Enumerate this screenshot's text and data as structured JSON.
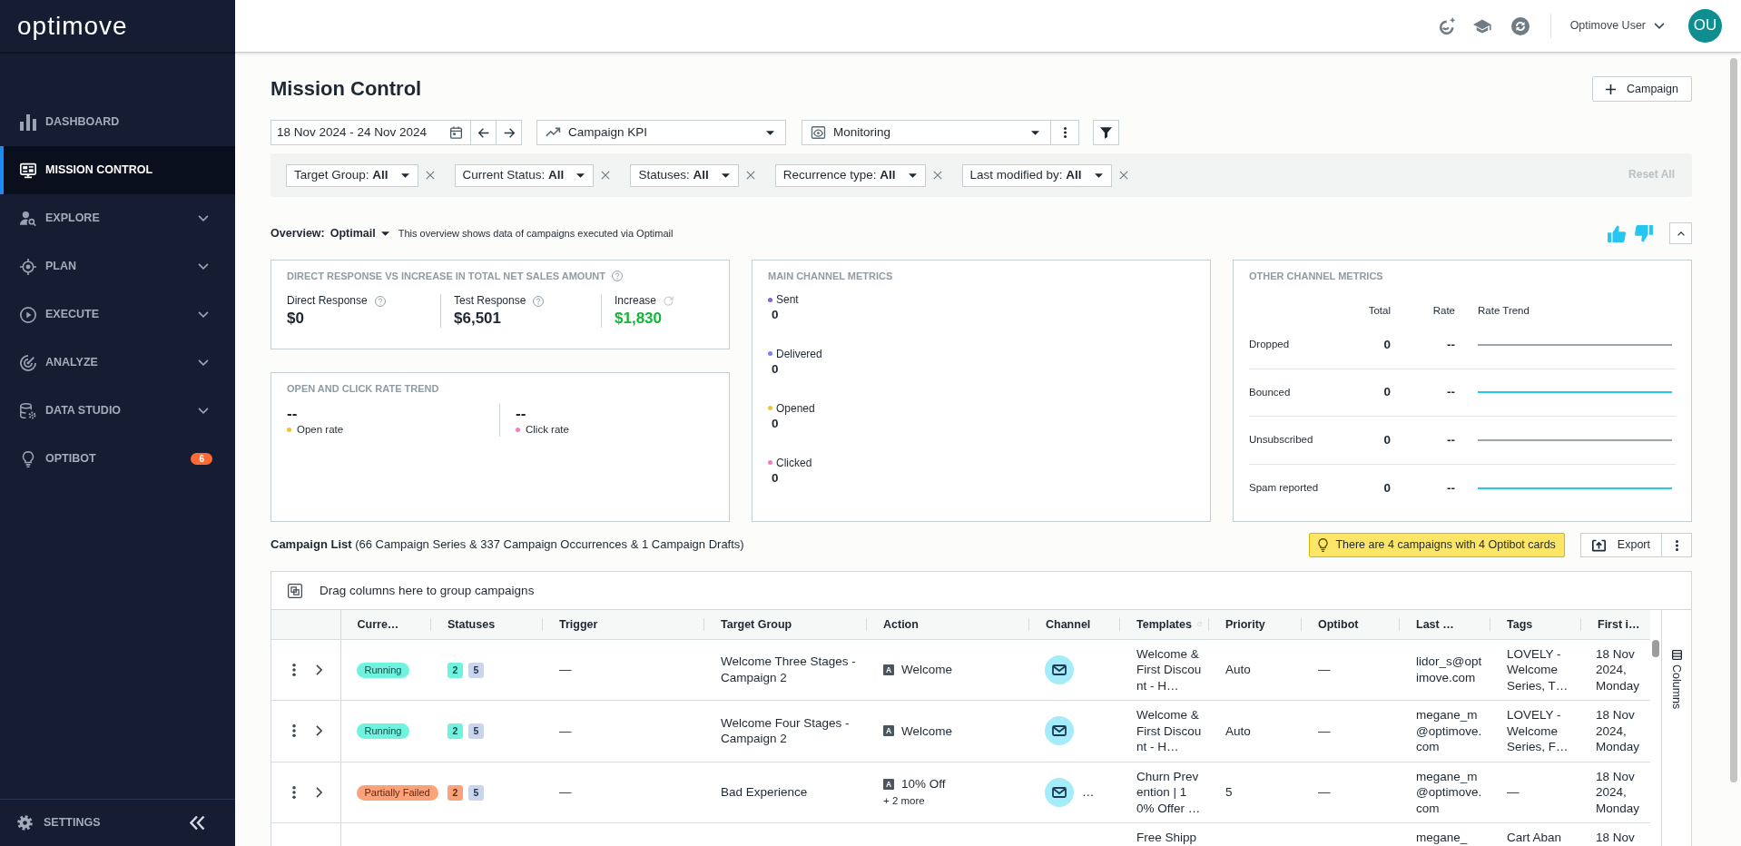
{
  "sidebar": {
    "logo": "optimove",
    "items": [
      {
        "label": "DASHBOARD",
        "selected": false,
        "expandable": false
      },
      {
        "label": "MISSION CONTROL",
        "selected": true,
        "expandable": false
      },
      {
        "label": "EXPLORE",
        "selected": false,
        "expandable": true
      },
      {
        "label": "PLAN",
        "selected": false,
        "expandable": true
      },
      {
        "label": "EXECUTE",
        "selected": false,
        "expandable": true
      },
      {
        "label": "ANALYZE",
        "selected": false,
        "expandable": true
      },
      {
        "label": "DATA STUDIO",
        "selected": false,
        "expandable": true
      },
      {
        "label": "OPTIBOT",
        "selected": false,
        "expandable": false,
        "badge": "6"
      }
    ],
    "footer": {
      "label": "SETTINGS"
    }
  },
  "header": {
    "user": "Optimove User",
    "avatar": "OU"
  },
  "page": {
    "title": "Mission Control",
    "add_button": "Campaign"
  },
  "toolbar": {
    "date_range": "18 Nov 2024 - 24 Nov 2024",
    "kpi": "Campaign KPI",
    "view": "Monitoring"
  },
  "filters": {
    "chips": [
      {
        "text": "Target Group: **All**"
      },
      {
        "text": "Current Status: **All**"
      },
      {
        "text": "Statuses: **All**"
      },
      {
        "text": "Recurrence type: **All**"
      },
      {
        "text": "Last modified by: **All**"
      }
    ],
    "reset": {
      "label": "Reset All",
      "disabled": true
    }
  },
  "overview": {
    "label": "Overview:",
    "source": "Optimail",
    "note": "This overview shows data of campaigns executed via Optimail"
  },
  "direct_response": {
    "title": "DIRECT RESPONSE VS INCREASE IN TOTAL NET SALES AMOUNT",
    "metrics": [
      {
        "kind": "help",
        "label": "Direct Response",
        "value": "$0"
      },
      {
        "kind": "help",
        "label": "Test Response",
        "value": "$6,501"
      },
      {
        "kind": "increase",
        "label": "Increase",
        "value": "$1,830"
      }
    ]
  },
  "open_click": {
    "title": "OPEN AND CLICK RATE TREND",
    "metrics": [
      {
        "label": "Open rate",
        "value": "--",
        "color": "#f2c230"
      },
      {
        "label": "Click rate",
        "value": "--",
        "color": "#f07ec0"
      }
    ]
  },
  "main_channel": {
    "title": "MAIN CHANNEL METRICS",
    "metrics": [
      {
        "label": "Sent",
        "value": "0",
        "color": "#8b5fd6"
      },
      {
        "label": "Delivered",
        "value": "0",
        "color": "#7c83e6"
      },
      {
        "label": "Opened",
        "value": "0",
        "color": "#f2c230"
      },
      {
        "label": "Clicked",
        "value": "0",
        "color": "#f07ec0"
      }
    ]
  },
  "other_channel": {
    "title": "OTHER CHANNEL METRICS",
    "columns": [
      "Total",
      "Rate",
      "Rate Trend"
    ],
    "rows": [
      {
        "label": "Dropped",
        "total": "0",
        "rate": "--",
        "color": "#9aa4a9"
      },
      {
        "label": "Bounced",
        "total": "0",
        "rate": "--",
        "color": "#25c6f2"
      },
      {
        "label": "Unsubscribed",
        "total": "0",
        "rate": "--",
        "color": "#9aa4a9"
      },
      {
        "label": "Spam reported",
        "total": "0",
        "rate": "--",
        "color": "#25c6f2"
      }
    ]
  },
  "campaign_list": {
    "heading": "**Campaign List** (66 Campaign Series & 337 Campaign Occurrences & 1 Campaign Drafts)",
    "optibot_alert": "There are 4 campaigns with 4 Optibot cards",
    "export": "Export",
    "group_hint": "Drag columns here to group campaigns",
    "columns": [
      {
        "label": "Curre…",
        "kind": "plain"
      },
      {
        "label": "Statuses",
        "kind": "plain"
      },
      {
        "label": "Trigger",
        "kind": "plain"
      },
      {
        "label": "Target Group",
        "kind": "plain"
      },
      {
        "label": "Action",
        "kind": "plain"
      },
      {
        "label": "Channel",
        "kind": "plain"
      },
      {
        "label": "Templates",
        "kind": "refresh"
      },
      {
        "label": "Priority",
        "kind": "plain"
      },
      {
        "label": "Optibot",
        "kind": "plain"
      },
      {
        "label": "Last …",
        "kind": "plain"
      },
      {
        "label": "Tags",
        "kind": "plain"
      },
      {
        "label": "First i…",
        "kind": "plain"
      }
    ],
    "rows": [
      {
        "current": {
          "label": "Running",
          "kind": "running"
        },
        "statuses": [
          {
            "count": "2",
            "kind": "running"
          },
          {
            "count": "5",
            "kind": "total"
          }
        ],
        "trigger": "—",
        "target_group": "Welcome Three Stages - Campaign 2",
        "action": {
          "tag": "A",
          "name": "Welcome"
        },
        "channel": {
          "kind": "email"
        },
        "template": "Welcome & First Discount - H…",
        "priority": "Auto",
        "optibot": "—",
        "last": "lidor_s@optimove.com",
        "tags": "LOVELY - Welcome Series, T…",
        "first": "18 Nov 2024, Monday"
      },
      {
        "current": {
          "label": "Running",
          "kind": "running"
        },
        "statuses": [
          {
            "count": "2",
            "kind": "running"
          },
          {
            "count": "5",
            "kind": "total"
          }
        ],
        "trigger": "—",
        "target_group": "Welcome Four Stages - Campaign 2",
        "action": {
          "tag": "A",
          "name": "Welcome"
        },
        "channel": {
          "kind": "email"
        },
        "template": "Welcome & First Discount - H…",
        "priority": "Auto",
        "optibot": "—",
        "last": "megane_m@optimove.com",
        "tags": "LOVELY - Welcome Series, F…",
        "first": "18 Nov 2024, Monday"
      },
      {
        "current": {
          "label": "Partially Failed",
          "kind": "failed"
        },
        "statuses": [
          {
            "count": "2",
            "kind": "failed"
          },
          {
            "count": "5",
            "kind": "total"
          }
        ],
        "trigger": "—",
        "target_group": "Bad Experience",
        "action": {
          "tag": "A",
          "name": "10% Off",
          "more": "+ 2 more"
        },
        "channel": {
          "kind": "email",
          "more": "…"
        },
        "template": "Churn Prevention | 10% Offer …",
        "priority": "5",
        "optibot": "—",
        "last": "megane_m@optimove.com",
        "tags": "—",
        "first": "18 Nov 2024, Monday"
      },
      {
        "template": "Free Shipp",
        "last": "megane_",
        "tags": "Cart Aban",
        "first": "18 Nov"
      }
    ],
    "side_panel": "Columns"
  }
}
